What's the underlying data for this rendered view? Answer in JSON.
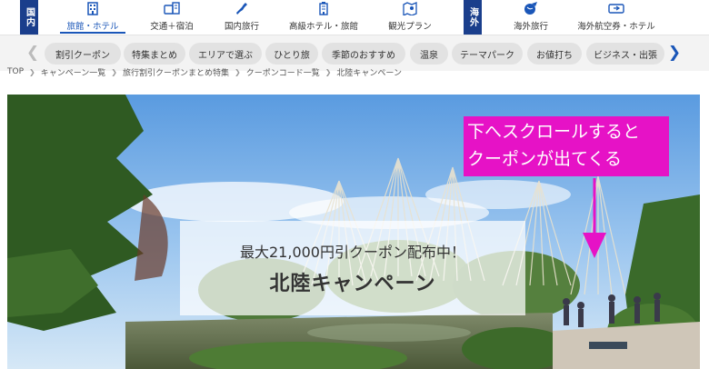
{
  "topnav": {
    "domestic_tag": "国内",
    "overseas_tag": "海外",
    "items": [
      {
        "label": "旅館・ホテル",
        "icon": "hotel-icon"
      },
      {
        "label": "交通＋宿泊",
        "icon": "transport-icon"
      },
      {
        "label": "国内旅行",
        "icon": "japan-map-icon"
      },
      {
        "label": "高級ホテル・旅館",
        "icon": "luxury-hotel-icon"
      },
      {
        "label": "観光プラン",
        "icon": "sightseeing-map-icon"
      },
      {
        "label": "海外旅行",
        "icon": "globe-plane-icon"
      },
      {
        "label": "海外航空券・ホテル",
        "icon": "ticket-icon"
      }
    ],
    "accent_color": "#1a56b8",
    "tag_color": "#1a3e8c"
  },
  "chips": [
    "割引クーポン",
    "特集まとめ",
    "エリアで選ぶ",
    "ひとり旅",
    "季節のおすすめ",
    "温泉",
    "テーマパーク",
    "お値打ち",
    "ビジネス・出張"
  ],
  "breadcrumb": [
    "TOP",
    "キャンペーン一覧",
    "旅行割引クーポンまとめ特集",
    "クーポンコード一覧",
    "北陸キャンペーン"
  ],
  "hero": {
    "subtitle": "最大21,000円引クーポン配布中！",
    "title": "北陸キャンペーン"
  },
  "annotation": {
    "line1": "下へスクロールすると",
    "line2": "クーポンが出てくる",
    "color": "#e612c6"
  }
}
